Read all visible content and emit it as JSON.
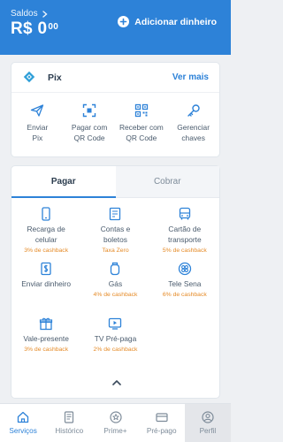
{
  "header": {
    "saldos_label": "Saldos",
    "balance_main": "R$ 0",
    "balance_cents": "00",
    "add_money_label": "Adicionar dinheiro"
  },
  "pix": {
    "title": "Pix",
    "see_more": "Ver mais",
    "actions": [
      {
        "label": "Enviar\nPix",
        "icon": "send-icon"
      },
      {
        "label": "Pagar com\nQR Code",
        "icon": "qr-scan-icon"
      },
      {
        "label": "Receber com\nQR Code",
        "icon": "qr-code-icon"
      },
      {
        "label": "Gerenciar\nchaves",
        "icon": "key-icon"
      }
    ]
  },
  "tabs": {
    "pay": "Pagar",
    "charge": "Cobrar"
  },
  "services": [
    {
      "name": "Recarga de\ncelular",
      "tag": "3% de cashback",
      "icon": "phone-icon"
    },
    {
      "name": "Contas e\nboletos",
      "tag": "Taxa Zero",
      "icon": "bill-icon"
    },
    {
      "name": "Cartão de\ntransporte",
      "tag": "5% de cashback",
      "icon": "bus-icon"
    },
    {
      "name": "Enviar dinheiro",
      "tag": "",
      "icon": "money-icon"
    },
    {
      "name": "Gás",
      "tag": "4% de cashback",
      "icon": "gas-icon"
    },
    {
      "name": "Tele Sena",
      "tag": "6% de cashback",
      "icon": "clover-icon"
    },
    {
      "name": "Vale-presente",
      "tag": "3% de cashback",
      "icon": "gift-icon"
    },
    {
      "name": "TV Pré-paga",
      "tag": "2% de cashback",
      "icon": "tv-icon"
    }
  ],
  "tabbar": [
    {
      "label": "Serviços",
      "icon": "home-icon"
    },
    {
      "label": "Histórico",
      "icon": "history-icon"
    },
    {
      "label": "Prime+",
      "icon": "star-icon"
    },
    {
      "label": "Pré-pago",
      "icon": "card-icon"
    },
    {
      "label": "Perfil",
      "icon": "profile-icon"
    }
  ],
  "colors": {
    "brand_blue": "#2d82d8",
    "cashback_orange": "#e58a26",
    "background": "#eef0f3"
  }
}
